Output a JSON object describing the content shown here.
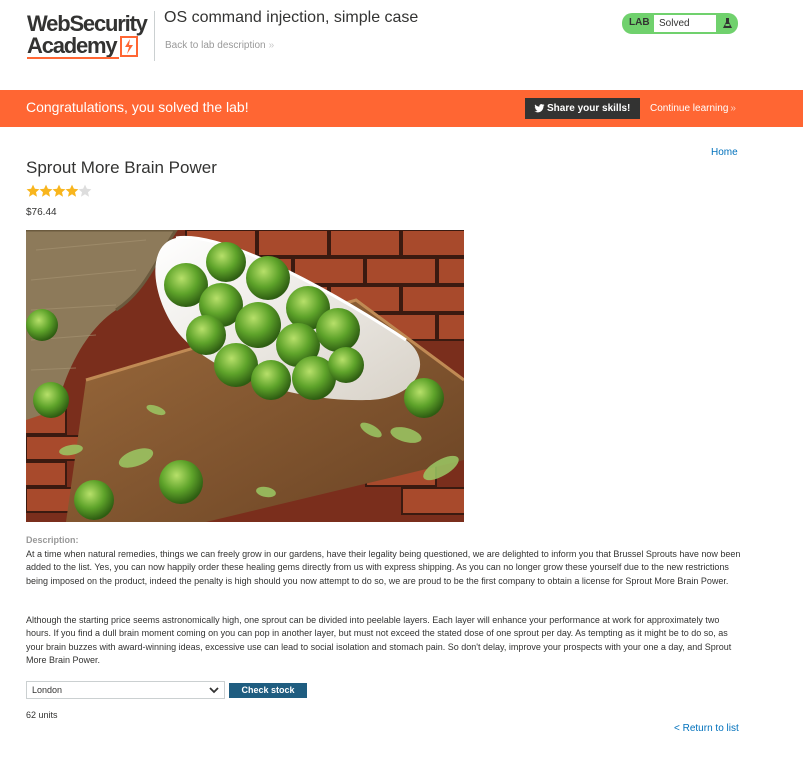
{
  "academy": {
    "logo_line1": "WebSecurity",
    "logo_line2": "Academy",
    "lab_title": "OS command injection, simple case",
    "back_link": "Back to lab description",
    "status_label": "LAB",
    "status_value": "Solved"
  },
  "banner": {
    "message": "Congratulations, you solved the lab!",
    "share_label": "Share your skills!",
    "continue_label": "Continue learning"
  },
  "nav": {
    "home": "Home",
    "return_link": "< Return to list"
  },
  "product": {
    "name": "Sprout More Brain Power",
    "rating": 4,
    "rating_max": 5,
    "price": "$76.44",
    "description_label": "Description:",
    "description_paragraphs": [
      "At a time when natural remedies, things we can freely grow in our gardens, have their legality being questioned, we are delighted to inform you that Brussel Sprouts have now been added to the list. Yes, you can now happily order these healing gems directly from us with express shipping. As you can no longer grow these yourself due to the new restrictions being imposed on the product, indeed the penalty is high should you now attempt to do so, we are proud to be the first company to obtain a license for Sprout More Brain Power.",
      "Although the starting price seems astronomically high, one sprout can be divided into peelable layers. Each layer will enhance your performance at work for approximately two hours. If you find a dull brain moment coming on you can pop in another layer, but must not exceed the stated dose of one sprout per day. As tempting as it might be to do so, as your brain buzzes with award-winning ideas, excessive use can lead to social isolation and stomach pain. So don't delay, improve your prospects with your one a day, and Sprout More Brain Power."
    ]
  },
  "stock": {
    "selected_store": "London",
    "check_label": "Check stock",
    "result": "62 units"
  },
  "colors": {
    "brand_orange": "#ff6633",
    "solved_green": "#70d16d",
    "link_blue": "#0071bc",
    "button_blue": "#1f5d80",
    "star_gold": "#f8b51d",
    "star_grey": "#dddddd"
  },
  "icons": {
    "twitter": "twitter-icon",
    "lab_flask": "flask-icon",
    "dropdown": "chevron-down-icon",
    "star": "star-icon"
  }
}
